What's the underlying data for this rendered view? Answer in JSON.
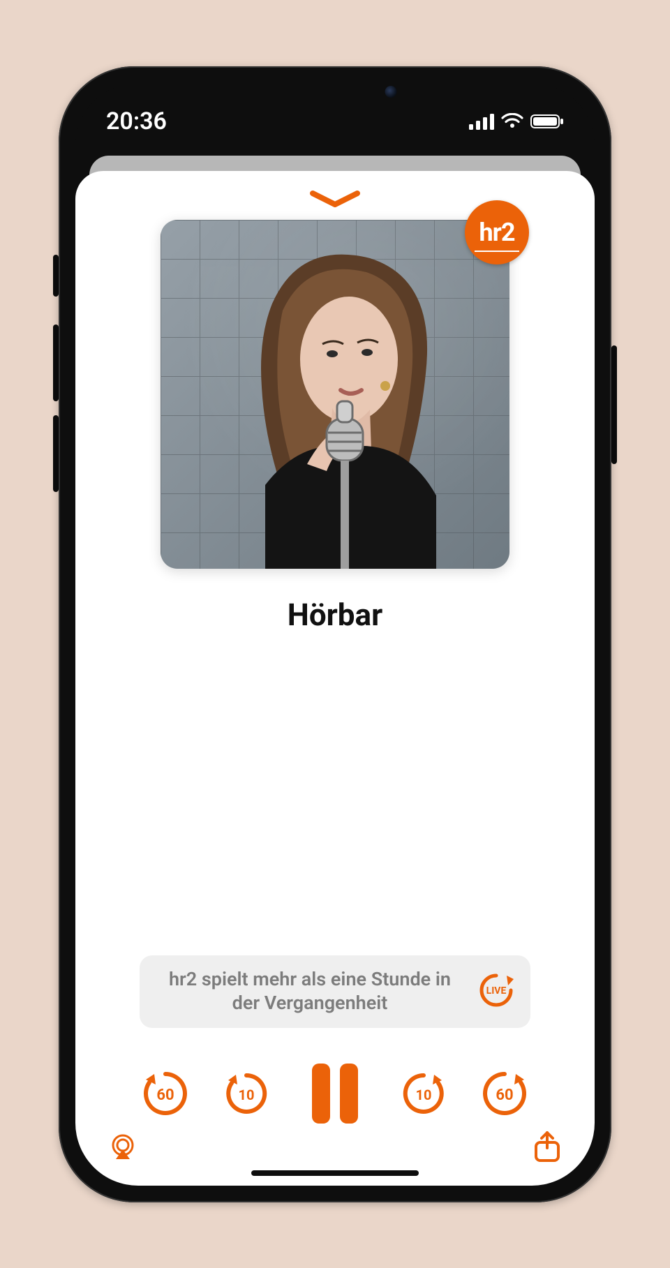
{
  "status": {
    "time": "20:36"
  },
  "station": {
    "badge": "hr2",
    "name": "hr2"
  },
  "now_playing": {
    "title": "Hörbar",
    "banner_text": "hr2 spielt mehr als eine Stunde in der Vergangenheit",
    "live_label": "LIVE"
  },
  "controls": {
    "back_60": "60",
    "back_10": "10",
    "fwd_10": "10",
    "fwd_60": "60"
  },
  "colors": {
    "accent": "#eb6209"
  }
}
